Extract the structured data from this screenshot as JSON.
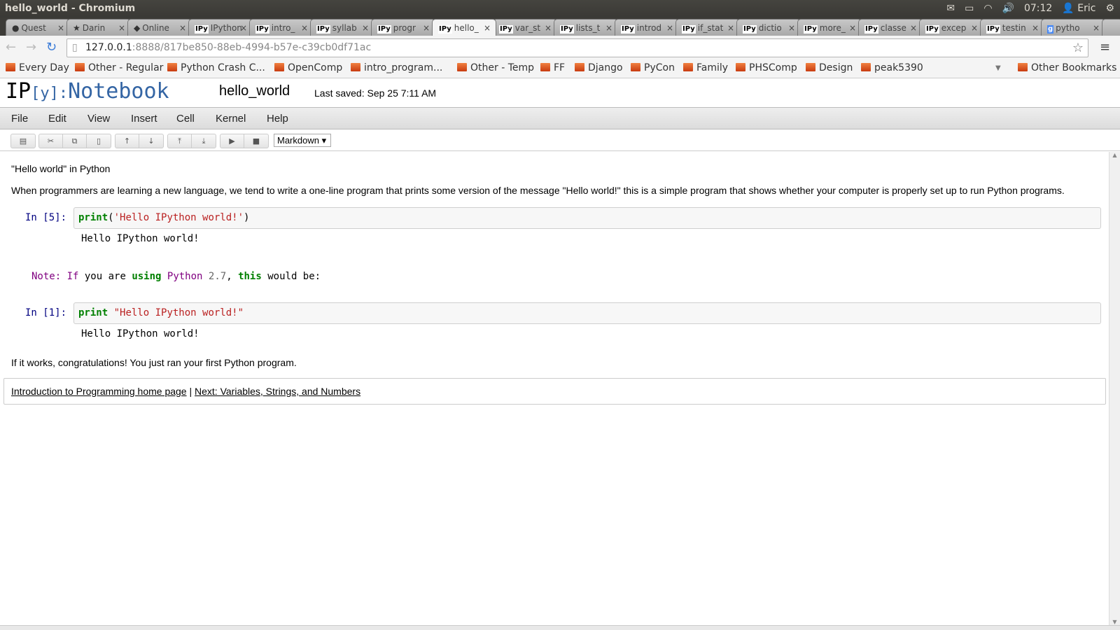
{
  "window": {
    "title": "hello_world - Chromium",
    "tray": {
      "time": "07:12",
      "user": "Eric"
    }
  },
  "tabs": [
    {
      "favicon": "github-icon",
      "label": "Quest"
    },
    {
      "favicon": "star-icon",
      "label": "Darin"
    },
    {
      "favicon": "python-icon",
      "label": "Online"
    },
    {
      "favicon": "IPy",
      "label": "IPython"
    },
    {
      "favicon": "IPy",
      "label": "intro_"
    },
    {
      "favicon": "IPy",
      "label": "syllab"
    },
    {
      "favicon": "IPy",
      "label": "progr"
    },
    {
      "favicon": "IPy",
      "label": "hello_",
      "active": true
    },
    {
      "favicon": "IPy",
      "label": "var_st"
    },
    {
      "favicon": "IPy",
      "label": "lists_t"
    },
    {
      "favicon": "IPy",
      "label": "introd"
    },
    {
      "favicon": "IPy",
      "label": "if_stat"
    },
    {
      "favicon": "IPy",
      "label": "dictio"
    },
    {
      "favicon": "IPy",
      "label": "more_"
    },
    {
      "favicon": "IPy",
      "label": "classe"
    },
    {
      "favicon": "IPy",
      "label": "excep"
    },
    {
      "favicon": "IPy",
      "label": "testin"
    },
    {
      "favicon": "g",
      "label": "pytho"
    }
  ],
  "address": {
    "host": "127.0.0.1",
    "rest": ":8888/817be850-88eb-4994-b57e-c39cb0df71ac"
  },
  "bookmarks": [
    "Every Day",
    "Other - Regular",
    "Python Crash C...",
    "OpenComp",
    "intro_program...",
    "Other - Temp",
    "FF",
    "Django",
    "PyCon",
    "Family",
    "PHSComp",
    "Design",
    "peak5390"
  ],
  "other_bookmarks": "Other Bookmarks",
  "ipython": {
    "logo_ip": "IP",
    "logo_y": "[y]:",
    "logo_nb": "Notebook",
    "notebook_name": "hello_world",
    "last_saved": "Last saved: Sep 25 7:11 AM"
  },
  "menu": [
    "File",
    "Edit",
    "View",
    "Insert",
    "Cell",
    "Kernel",
    "Help"
  ],
  "toolbar": {
    "cell_type": "Markdown ▾"
  },
  "notebook": {
    "heading": "\"Hello world\" in Python",
    "intro": "When programmers are learning a new language, we tend to write a one-line program that prints some version of the message \"Hello world!\" this is a simple program that shows whether your computer is properly set up to run Python programs.",
    "cell1": {
      "prompt": "In [5]:",
      "fn": "print",
      "open": "(",
      "str": "'Hello IPython world!'",
      "close": ")",
      "output": "Hello IPython world!"
    },
    "note": {
      "a": "Note:",
      "b": " If",
      "c": " you are ",
      "d": "using",
      "e": " Python",
      "f": " 2.7",
      ",": ",",
      "g": " this",
      "h": " would be:"
    },
    "cell2": {
      "prompt": "In [1]:",
      "fn": "print",
      "str": " \"Hello IPython world!\"",
      "output": "Hello IPython world!"
    },
    "congrats": "If it works, congratulations! You just ran your first Python program.",
    "links": {
      "home": "Introduction to Programming home page",
      "sep": " | ",
      "next": "Next: Variables, Strings, and Numbers"
    }
  }
}
